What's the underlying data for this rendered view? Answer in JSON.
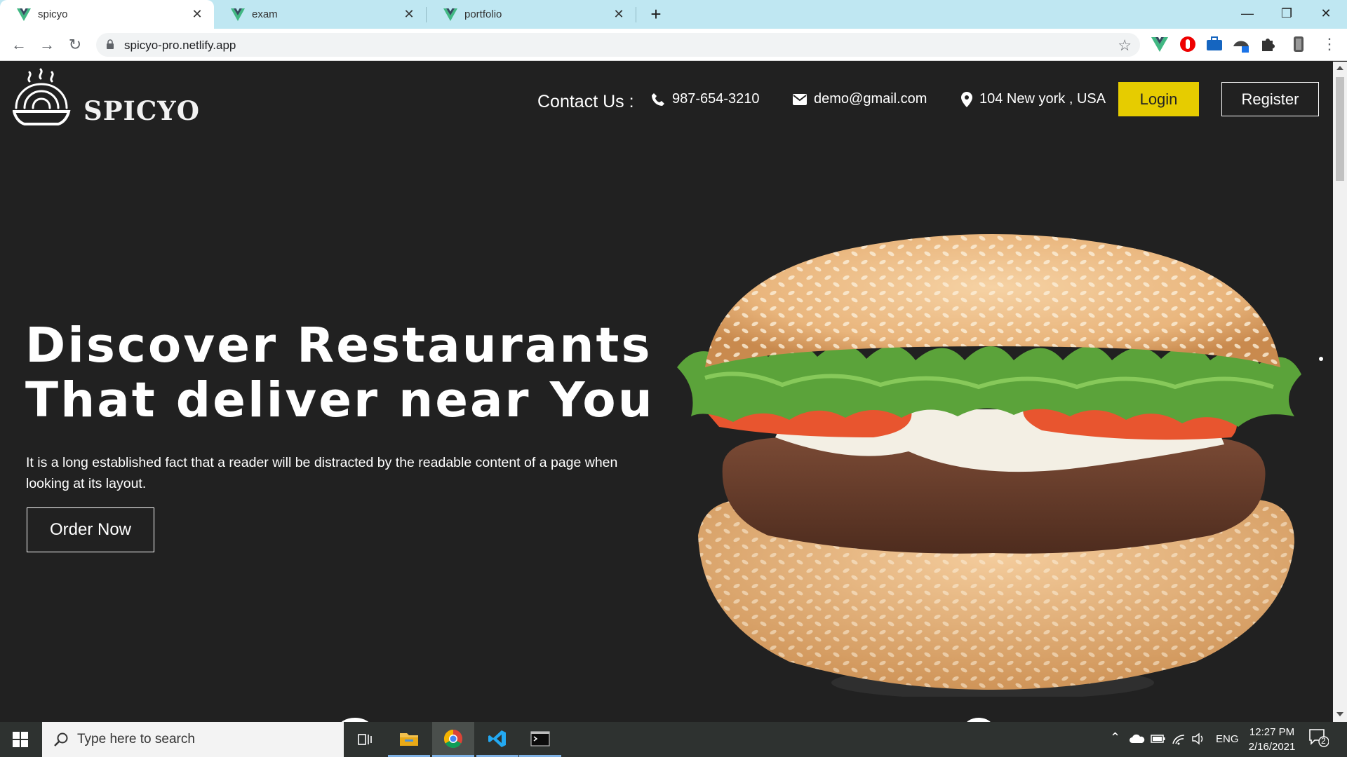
{
  "browser": {
    "tabs": [
      {
        "title": "spicyo",
        "active": true
      },
      {
        "title": "exam",
        "active": false
      },
      {
        "title": "portfolio",
        "active": false
      }
    ],
    "new_tab_label": "+",
    "url": "spicyo-pro.netlify.app"
  },
  "header": {
    "brand": "SPICYO",
    "contact_label": "Contact Us :",
    "phone": "987-654-3210",
    "email": "demo@gmail.com",
    "address": "104 New york , USA",
    "login_label": "Login",
    "register_label": "Register"
  },
  "hero": {
    "title_line1": "Discover Restaurants",
    "title_line2": "That deliver near You",
    "text": "It is a long established fact that a reader will be distracted by the readable content of a page when looking at its layout.",
    "order_label": "Order Now"
  },
  "taskbar": {
    "search_placeholder": "Type here to search",
    "language": "ENG",
    "time": "12:27 PM",
    "date": "2/16/2021",
    "notification_count": "2"
  },
  "colors": {
    "page_bg": "#212121",
    "login_button": "#e6cc00",
    "tab_strip": "#bfe7f2",
    "taskbar_bg": "#2e3230",
    "vue_green": "#41b883"
  },
  "icons": {
    "phone": "phone-icon",
    "email": "envelope-icon",
    "address": "map-pin-icon",
    "logo": "steaming-bowl-icon"
  }
}
